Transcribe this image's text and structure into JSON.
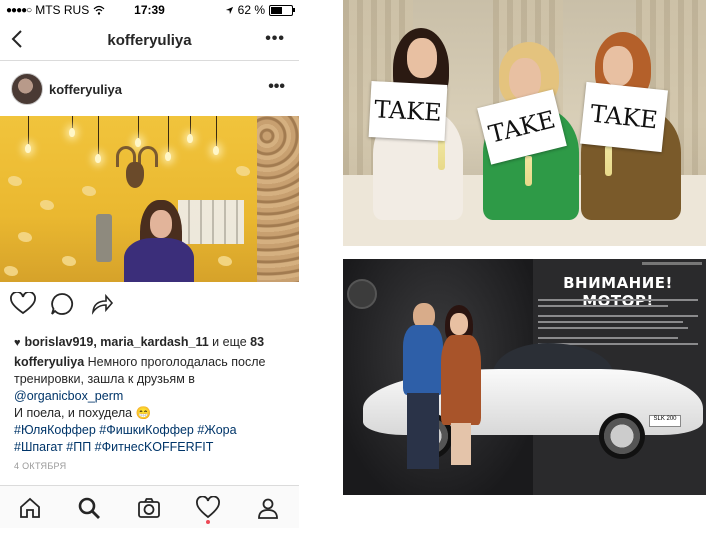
{
  "status_bar": {
    "signal": "●●●●○",
    "carrier": "MTS RUS",
    "wifi_icon": "wifi-icon",
    "time": "17:39",
    "location_icon": "location-arrow-icon",
    "battery": "62 %",
    "battery_level": 0.62
  },
  "nav": {
    "back_icon": "chevron-left-icon",
    "title": "kofferyuliya",
    "more_icon": "more-horizontal-icon"
  },
  "post": {
    "username": "kofferyuliya",
    "likes": {
      "names": "borislav919, maria_kardash_11",
      "connector": " и еще ",
      "count": "83"
    },
    "caption": {
      "username": "kofferyuliya",
      "line1": " Немного проголодалась после тренировки, зашла к друзьям в ",
      "link": "@organicbox_perm",
      "line2": "И поела, и похудела 😁",
      "hashtags1": "#ЮляКоффер #ФишкиКоффер #Жора",
      "hashtags2": "#Шпагат #ПП #ФитнесKOFFERFIT"
    },
    "date": "4 ОКТЯБРЯ"
  },
  "tabs": [
    "home-icon",
    "search-icon",
    "camera-icon",
    "heart-icon",
    "profile-icon"
  ],
  "right_images": {
    "top_signs": [
      "TAKE",
      "TAKE",
      "TAKE"
    ],
    "magazine_title": "ВНИМАНИЕ! МОТОР!",
    "plate": "SLK 200"
  },
  "colors": {
    "link": "#003569",
    "notification_dot": "#ed4956",
    "divider": "#dbdbdb"
  }
}
